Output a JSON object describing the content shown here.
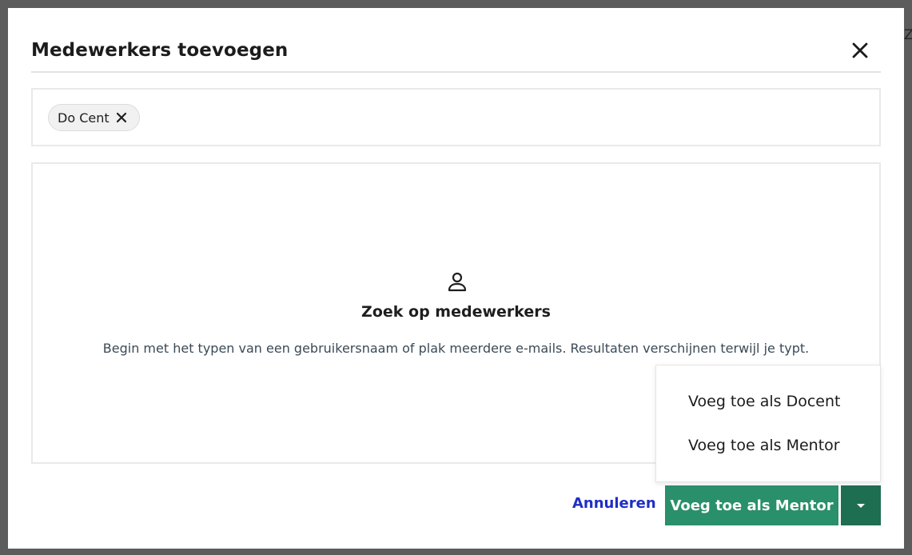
{
  "backdrop": {
    "peek_text": "Zo"
  },
  "dialog": {
    "title": "Medewerkers toevoegen",
    "close_icon": "close-icon"
  },
  "selected_chips": [
    {
      "label": "Do Cent",
      "remove_icon": "close-icon"
    }
  ],
  "empty_state": {
    "icon": "user-icon",
    "title": "Zoek op medewerkers",
    "description": "Begin met het typen van een gebruikersnaam of plak meerdere e-mails. Resultaten verschijnen terwijl je typt."
  },
  "add_menu": {
    "items": [
      {
        "label": "Voeg toe als Docent"
      },
      {
        "label": "Voeg toe als Mentor"
      }
    ]
  },
  "footer": {
    "cancel_label": "Annuleren",
    "primary_label": "Voeg toe als Mentor",
    "dropdown_icon": "caret-down-icon"
  },
  "colors": {
    "primary": "#2a8f6b",
    "primary_dark": "#1e6e51",
    "link": "#1f2fc4"
  }
}
